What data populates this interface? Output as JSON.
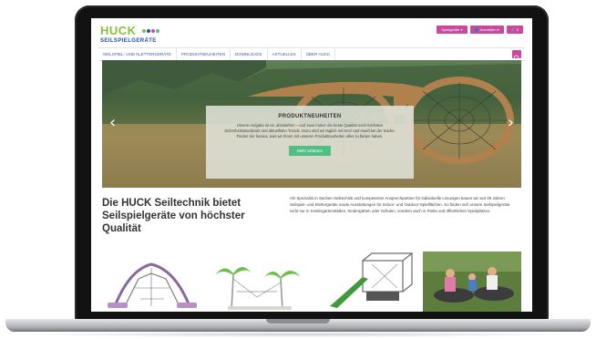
{
  "logo": {
    "brand": "HUCK",
    "subline": "SEILSPIELGERÄTE",
    "dot_colors": [
      "#8bbf3c",
      "#1f4fa3",
      "#c84a9e",
      "#4fbf84"
    ]
  },
  "header": {
    "buttons": [
      {
        "label": "Spielgeräte ▾",
        "icon": "caret-icon"
      },
      {
        "label": "👤 Anmelden ▾",
        "icon": "user-icon"
      },
      {
        "label": "🛒 0",
        "icon": "cart-icon"
      }
    ]
  },
  "nav": {
    "items": [
      "SEILSPIEL- UND KLETTERGERÄTE",
      "PRODUKTNEUHEITEN",
      "DOWNLOADS",
      "AKTUELLES",
      "ÜBER HUCK"
    ],
    "search_icon": "search-icon"
  },
  "hero": {
    "prev_arrow": "‹",
    "next_arrow": "›",
    "title": "PRODUKTNEUHEITEN",
    "text": "Unsere Aufgabe ist es, abzuliefern – und zwar immer die beste Qualität nach höchsten Sicherheitsstandards und aktuellsten Trends. Dazu sind wir täglich mit Herz und Hand bei der Sache. Finden Sie heraus, was wir Ihnen mit unseren Produktneuheiten alles zu bieten haben.",
    "button": "Mehr erfahren"
  },
  "intro": {
    "heading": "Die HUCK Seiltechnik bietet Seilspielgeräte von höchster Qualität",
    "text": "Als Spezialist in Sachen Seiltechnik und kompetenter Ansprechpartner für individuelle Lösungen bauen wir seit 29 Jahren Seilspiel- und Klettergeräte sowie Ausstattungen für Indoor- und Outdoor-Spielflächen. So finden sich unsere Seilspielgeräte nicht nur in Kindergartenstätten, Kindergärten oder Schulen, sondern auch in Parks und öffentlichen Spielplätzen."
  },
  "colors": {
    "accent": "#c84a9e",
    "brand_green": "#8bbf3c",
    "brand_blue": "#1f4fa3",
    "cta_green": "#4fbf84"
  }
}
